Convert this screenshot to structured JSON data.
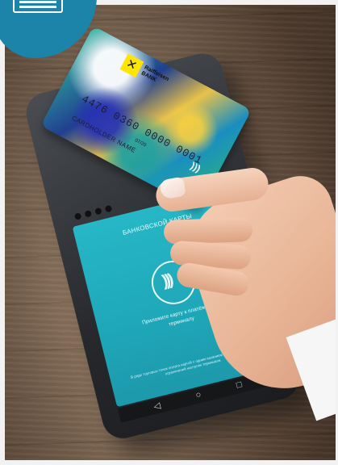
{
  "menu": {
    "icon": "hamburger-menu-icon"
  },
  "card": {
    "bank_name": "Raiffeisen BANK",
    "number": "4476 0360 0000 0001",
    "holder": "CARDHOLDER NAME",
    "expiry": "07/20",
    "contactless_icon": "contactless-icon"
  },
  "terminal": {
    "screen_title": "БАНКОВСКОЙ КАРТЫ",
    "screen_message": "Приложите карту к платёжному терминалу",
    "screen_note": "В ряде торговых точек оплата картой с одним касанием невозможна из-за ограничений настроек терминала",
    "nfc_icon": "nfc-icon",
    "nav": {
      "back": "◁",
      "home": "○",
      "recent": "□"
    }
  },
  "colors": {
    "badge": "#1b84a8",
    "screen": "#22b0c1"
  }
}
